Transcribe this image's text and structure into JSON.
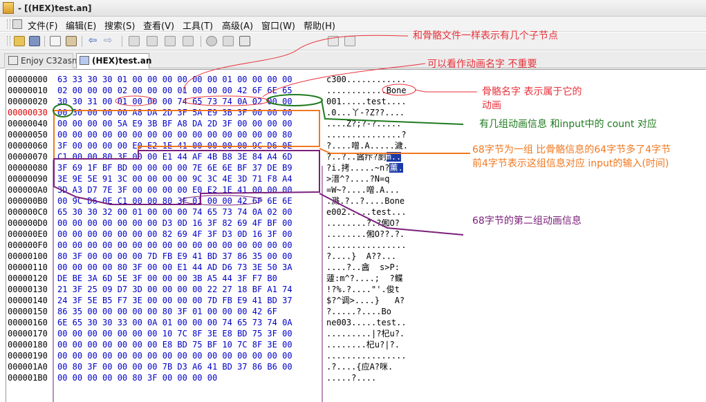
{
  "window": {
    "title": "- [(HEX)test.an]"
  },
  "menu": [
    {
      "label": "文件(F)"
    },
    {
      "label": "编辑(E)"
    },
    {
      "label": "搜索(S)"
    },
    {
      "label": "查看(V)"
    },
    {
      "label": "工具(T)"
    },
    {
      "label": "高级(A)"
    },
    {
      "label": "窗口(W)"
    },
    {
      "label": "帮助(H)"
    }
  ],
  "toolbar": [
    "open-icon",
    "save-icon",
    "copy-icon",
    "paste-icon",
    "back-arrow-icon",
    "forward-arrow-icon",
    "tool-1-icon",
    "tool-2-icon",
    "tool-3-icon",
    "tool-4-icon",
    "settings-icon",
    "tool-5-icon",
    "tool-6-icon",
    "tool-7-icon",
    "tool-8-icon"
  ],
  "tabs": [
    {
      "label": "Enjoy C32asm",
      "active": false
    },
    {
      "label": "(HEX)test.an",
      "active": true
    }
  ],
  "hex": {
    "highlight_offset": "00000030",
    "rows": [
      {
        "offset": "00000000",
        "bytes": "63 33 30 30 01 00 00 00 00 00 00 01 00 00 00 00",
        "ascii": "c300............"
      },
      {
        "offset": "00000010",
        "bytes": "02 00 00 00 02 00 00 00 01 00 00 00 42 6F 6E 65",
        "ascii": "............Bone"
      },
      {
        "offset": "00000020",
        "bytes": "30 30 31 00 01 00 00 00 74 65 73 74 0A 02 00 00",
        "ascii": "001.....test...."
      },
      {
        "offset": "00000030",
        "bytes": "00 30 00 00 00 A8 DA 2D 3F 5A E9 3B 3F 00 00 00",
        "ascii": ".0...丫-?Z??...."
      },
      {
        "offset": "00000040",
        "bytes": "00 00 00 00 5A E9 3B BF A8 DA 2D 3F 00 00 00 00",
        "ascii": "....Z?;?-?....."
      },
      {
        "offset": "00000050",
        "bytes": "00 00 00 00 00 00 00 00 00 00 00 00 00 00 00 80",
        "ascii": "...............?"
      },
      {
        "offset": "00000060",
        "bytes": "3F 00 00 00 00 E0 E2 1E 41 00 00 00 00 9C D6 0E",
        "ascii": "?....噌.A.....濊."
      },
      {
        "offset": "00000070",
        "bytes": "C1 00 00 80 3F 00 00 E1 44 AF 4B B8 3E 84 A4 6D",
        "ascii": "?..?..酓疜?剫m..",
        "sel": "m.."
      },
      {
        "offset": "00000080",
        "bytes": "3F 69 1F BF BD 00 00 00 00 7E 6E 6E BF 37 DE B9",
        "ascii": "?i.拷.....~n?薰.",
        "sel": "薰."
      },
      {
        "offset": "00000090",
        "bytes": "3E 9E 5E 91 3C 00 00 00 00 9C 3C 4E 3D 71 F8 A4",
        "ascii": ">溍^?....?N=q"
      },
      {
        "offset": "000000A0",
        "bytes": "3D A3 D7 7E 3F 00 00 00 00 E0 E2 1E 41 00 00 00",
        "ascii": "=W~?....噌.A..."
      },
      {
        "offset": "000000B0",
        "bytes": "00 9C D6 0E C1 00 00 80 3F 01 00 00 42 6F 6E 6E",
        "ascii": ".溅.?..?....Bone"
      },
      {
        "offset": "000000C0",
        "bytes": "65 30 30 32 00 01 00 00 00 74 65 73 74 0A 02 00",
        "ascii": "e002.....test..."
      },
      {
        "offset": "000000D0",
        "bytes": "00 00 00 00 00 00 00 D3 0D 16 3F 82 69 4F BF 00",
        "ascii": "........?.?俰O?"
      },
      {
        "offset": "000000E0",
        "bytes": "00 00 00 00 00 00 00 82 69 4F 3F D3 0D 16 3F 00",
        "ascii": "........俰O??.?."
      },
      {
        "offset": "000000F0",
        "bytes": "00 00 00 00 00 00 00 00 00 00 00 00 00 00 00 00",
        "ascii": "................"
      },
      {
        "offset": "00000100",
        "bytes": "80 3F 00 00 00 00 7D FB E9 41 BD 37 86 35 00 00",
        "ascii": "?....}  A??..."
      },
      {
        "offset": "00000110",
        "bytes": "00 00 00 00 80 3F 00 00 E1 44 AD D6 73 3E 50 3A",
        "ascii": "....?..酓  s>P:"
      },
      {
        "offset": "00000120",
        "bytes": "DE BE 3A 6D 5E 3F 00 00 00 3B A5 44 3F F7 B0",
        "ascii": "蘧:m^?....;  ?鲽"
      },
      {
        "offset": "00000130",
        "bytes": "21 3F 25 09 D7 3D 00 00 00 00 22 27 18 BF A1 74",
        "ascii": "!?%.?....\"'.俊t"
      },
      {
        "offset": "00000140",
        "bytes": "24 3F 5E B5 F7 3E 00 00 00 00 7D FB E9 41 BD 37",
        "ascii": "$?^调>....}   A?"
      },
      {
        "offset": "00000150",
        "bytes": "86 35 00 00 00 00 00 80 3F 01 00 00 00 42 6F",
        "ascii": "?.....?....Bo"
      },
      {
        "offset": "00000160",
        "bytes": "6E 65 30 30 33 00 0A 01 00 00 00 74 65 73 74 0A",
        "ascii": "ne003.....test.."
      },
      {
        "offset": "00000170",
        "bytes": "00 00 00 00 00 00 00 10 7C 8F 3E E8 BD 75 3F 00",
        "ascii": ".........|?杞u?."
      },
      {
        "offset": "00000180",
        "bytes": "00 00 00 00 00 00 00 E8 BD 75 BF 10 7C 8F 3E 00",
        "ascii": "........杞u?|?."
      },
      {
        "offset": "00000190",
        "bytes": "00 00 00 00 00 00 00 00 00 00 00 00 00 00 00 00",
        "ascii": "................"
      },
      {
        "offset": "000001A0",
        "bytes": "00 80 3F 00 00 00 00 7B D3 A6 41 BD 37 86 B6 00",
        "ascii": ".?....{应A?咪."
      },
      {
        "offset": "000001B0",
        "bytes": "00 00 00 00 00 80 3F 00 00 00 00",
        "ascii": ".....?...."
      }
    ]
  },
  "annotations": [
    {
      "id": "note-bone-count",
      "text": "和骨骼文件一样表示有几个子节点",
      "color": "#e8313a"
    },
    {
      "id": "note-anim-name",
      "text": "可以看作动画名字 不重要",
      "color": "#e8313a"
    },
    {
      "id": "note-bone-name-1",
      "text": "骨骼名字 表示属于它的",
      "color": "#e8313a"
    },
    {
      "id": "note-bone-name-2",
      "text": "动画",
      "color": "#e8313a"
    },
    {
      "id": "note-count",
      "text": "有几组动画信息 和input中的 count 对应",
      "color": "#1f7a1f"
    },
    {
      "id": "note-68-1",
      "text": "68字节为一组 比骨骼信息的64字节多了4字节",
      "color": "#f07820"
    },
    {
      "id": "note-68-2",
      "text": "前4字节表示这组信息对应 input的输入(时间)",
      "color": "#f07820"
    },
    {
      "id": "note-second",
      "text": "68字节的第二组动画信息",
      "color": "#7a1f7a"
    }
  ]
}
